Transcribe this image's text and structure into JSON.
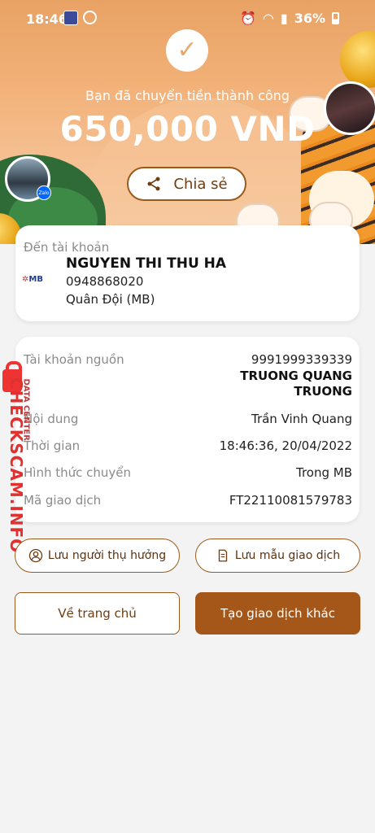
{
  "status_bar": {
    "time": "18:46",
    "battery": "36%"
  },
  "hero": {
    "success_text": "Bạn đã chuyển tiền thành công",
    "amount": "650,000 VND",
    "share_label": "Chia sẻ"
  },
  "destination": {
    "label": "Đến tài khoản",
    "bank_logo_text": "MB",
    "name": "NGUYEN THI THU HA",
    "account_number": "0948868020",
    "bank_name": "Quân Đội (MB)"
  },
  "details": {
    "source": {
      "label": "Tài khoản nguồn",
      "account": "9991999339339",
      "name_line1": "TRUONG QUANG",
      "name_line2": "TRUONG"
    },
    "rows": [
      {
        "label": "Nội dung",
        "value": "Trần Vinh Quang"
      },
      {
        "label": "Thời gian",
        "value": "18:46:36, 20/04/2022"
      },
      {
        "label": "Hình thức chuyển",
        "value": "Trong MB"
      },
      {
        "label": "Mã giao dịch",
        "value": "FT22110081579783"
      }
    ]
  },
  "actions": {
    "save_beneficiary": "Lưu người thụ hưởng",
    "save_template": "Lưu mẫu giao dịch",
    "home": "Về trang chủ",
    "new_transaction": "Tạo giao dịch khác"
  },
  "watermark": {
    "site": "CHECKSCAM.INFO",
    "sub": "DATA CENTER"
  },
  "zalo_badge": "Zalo",
  "colors": {
    "brand": "#a5571a",
    "accent_border": "#9a5a1c",
    "hero_bg": "#f2b178"
  },
  "icons": [
    "share-icon",
    "person-icon",
    "document-icon",
    "check-icon",
    "lock-icon"
  ]
}
